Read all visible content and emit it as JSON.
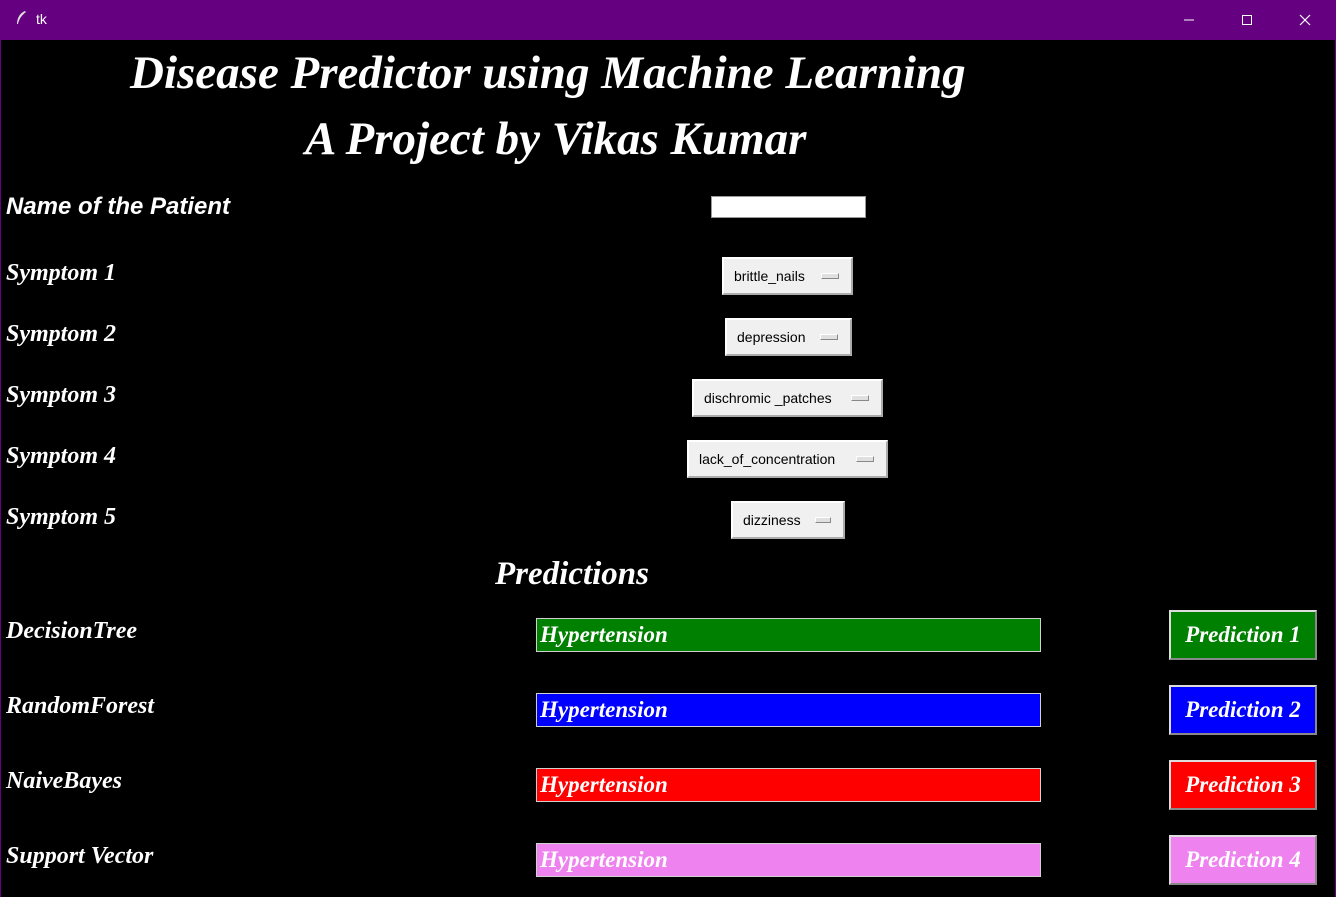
{
  "window": {
    "title": "tk",
    "titlebar_color": "#650080",
    "background": "#000000"
  },
  "header": {
    "title": "Disease Predictor using Machine Learning",
    "subtitle": "A Project by Vikas Kumar"
  },
  "form": {
    "name_label": "Name of the Patient",
    "name_value": "",
    "symptoms": [
      {
        "label": "Symptom 1",
        "value": "brittle_nails"
      },
      {
        "label": "Symptom 2",
        "value": "depression"
      },
      {
        "label": "Symptom 3",
        "value": "dischromic _patches"
      },
      {
        "label": "Symptom 4",
        "value": "lack_of_concentration"
      },
      {
        "label": "Symptom 5",
        "value": "dizziness"
      }
    ]
  },
  "predictions": {
    "heading": "Predictions",
    "models": [
      {
        "label": "DecisionTree",
        "result": "Hypertension",
        "button": "Prediction 1",
        "color": "#008000"
      },
      {
        "label": "RandomForest",
        "result": "Hypertension",
        "button": "Prediction 2",
        "color": "#0000ff"
      },
      {
        "label": "NaiveBayes",
        "result": "Hypertension",
        "button": "Prediction 3",
        "color": "#ff0000"
      },
      {
        "label": "Support Vector",
        "result": "Hypertension",
        "button": "Prediction 4",
        "color": "#ee82ee"
      }
    ]
  }
}
